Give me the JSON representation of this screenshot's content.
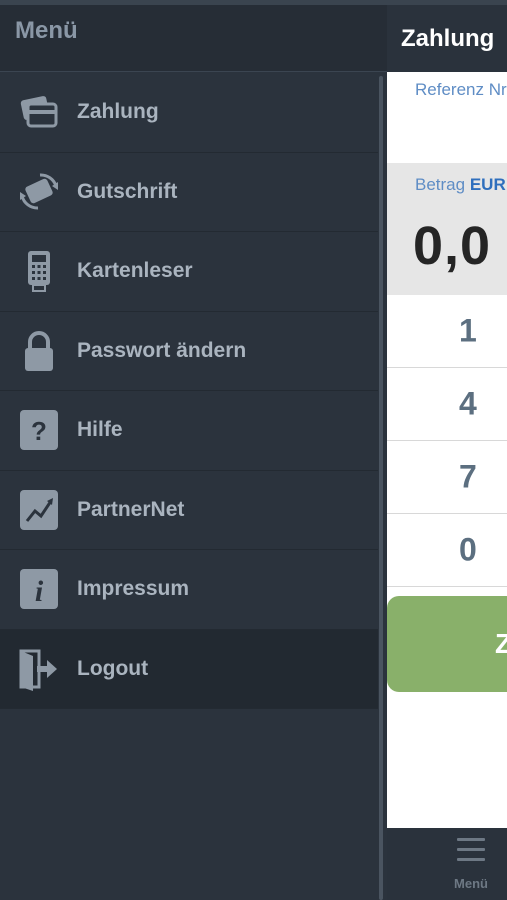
{
  "menu": {
    "title": "Menü",
    "items": [
      {
        "label": "Zahlung",
        "icon": "credit-cards-icon"
      },
      {
        "label": "Gutschrift",
        "icon": "card-refund-icon"
      },
      {
        "label": "Kartenleser",
        "icon": "card-reader-icon"
      },
      {
        "label": "Passwort ändern",
        "icon": "lock-icon"
      },
      {
        "label": "Hilfe",
        "icon": "help-icon"
      },
      {
        "label": "PartnerNet",
        "icon": "chart-icon"
      },
      {
        "label": "Impressum",
        "icon": "info-icon"
      },
      {
        "label": "Logout",
        "icon": "logout-icon"
      }
    ],
    "active_item": "Logout"
  },
  "main": {
    "title": "Zahlung",
    "reference_label": "Referenz Nr",
    "amount_label": "Betrag",
    "currency": "EUR",
    "amount_value": "0,0",
    "keypad": [
      "1",
      "4",
      "7",
      "0"
    ],
    "pay_button_label": "Z",
    "tabbar": {
      "menu_label": "Menü",
      "menu_icon": "hamburger-icon"
    }
  },
  "colors": {
    "menu_background": "#2b333d",
    "accent_green": "#89b06a",
    "link_blue": "#5f8dc5"
  }
}
